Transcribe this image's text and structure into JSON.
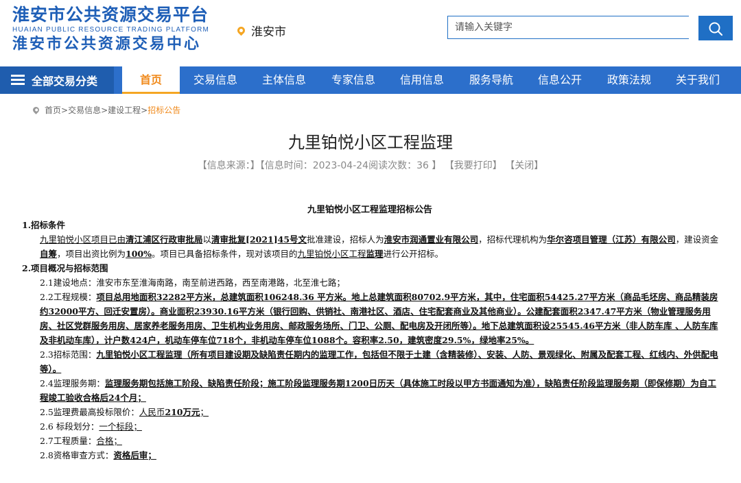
{
  "header": {
    "logo_line1": "淮安市公共资源交易平台",
    "logo_en": "HUAIAN PUBLIC RESOURCE TRADING PLATFORM",
    "logo_line2": "淮安市公共资源交易中心",
    "city": "淮安市",
    "search_placeholder": "请输入关键字"
  },
  "nav": {
    "all_label": "全部交易分类",
    "items": [
      "首页",
      "交易信息",
      "主体信息",
      "专家信息",
      "信用信息",
      "服务导航",
      "信息公开",
      "政策法规",
      "关于我们"
    ]
  },
  "breadcrumb": [
    "首页>",
    "交易信息>",
    "建设工程>",
    "招标公告"
  ],
  "article": {
    "title": "九里铂悦小区工程监理",
    "meta_source": "【信息来源：】",
    "meta_time": "【信息时间：2023-04-24阅读次数：36 】",
    "meta_print": "【我要打印】",
    "meta_close": "【关闭】"
  },
  "content": {
    "doc_title": "九里铂悦小区工程监理招标公告",
    "s1": "1.招标条件",
    "p1a": "九里铂悦小区项目已由",
    "p1b": "清江浦区行政审批局",
    "p1c": "以",
    "p1d": "清审批复[2021]45号文",
    "p1e": "批准建设，招标人为",
    "p1f": "淮安市润通置业有限公司",
    "p1g": "，招标代理机构为",
    "p1h": "华尔咨项目管理（江苏）有限公司",
    "p1i": "，建设资金",
    "p1j": "自筹",
    "p1k": "，项目出资比例为",
    "p1l": "100%",
    "p1m": "。项目已具备招标条件，现对该项目的",
    "p1n": "九里铂悦小区工程",
    "p1o": "监理",
    "p1p": "进行公开招标。",
    "s2": "2.项目概况与招标范围",
    "p21": "2.1建设地点：淮安市东至淮海南路，南至前进西路，西至南港路，北至淮七路；",
    "p22a": "2.2工程规模：",
    "p22b": "项目总用地面积32282平方米，总建筑面积106248.36 平方米。地上总建筑面积80702.9平方米，其中，住宅面积54425.27平方米（商品毛坯房、商品精装房约32000平方、回迁安置房）。商业面积23930.16平方米（银行回购、供销社、南港社区、酒店、住宅配套商业及其他商业）。公建配套面积2347.47平方米（物业管理服务用房、社区党群服务用房、居家养老服务用房、卫生机构业务用房、邮政服务场所、门卫、公厕、配电房及开闭所等）。地下总建筑面积设25545.46平方米（非人防车库 、人防车库及非机动车库），计户数424户，机动车停车位718个，非机动车停车位1088个。容积率2.50，建筑密度29.5%，绿地率25%。",
    "p23a": "2.3招标范围：",
    "p23b": "九里铂悦小区工程监理（所有项目建设期及缺陷责任期内的监理工作，包括但不限于土建（含精装修）、安装、人防、景观绿化、附属及配套工程、红线内、外供配电等）。",
    "p24a": "2.4监理服务期：",
    "p24b": "监理服务期包括施工阶段、缺陷责任阶段；施工阶段监理服务期1200日历天（具体施工时段以甲方书面通知为准），缺陷责任阶段监理服务期（即保修期）为自工程竣工验收合格后24个月；",
    "p25a": "2.5监理费最高投标限价：",
    "p25b": "人民币",
    "p25c": "210万元",
    "p25d": "；",
    "p26a": "2.6 标段划分：",
    "p26b": "一个标段",
    "p26c": "；",
    "p27a": "2.7工程质量：",
    "p27b": "合格",
    "p27c": "；",
    "p28a": "2.8资格审查方式：",
    "p28b": "资格后审",
    "p28c": "；"
  },
  "colors": {
    "brand_blue": "#1f5fb7",
    "nav_blue": "#2c6fcb",
    "accent_orange": "#f08a1c"
  }
}
